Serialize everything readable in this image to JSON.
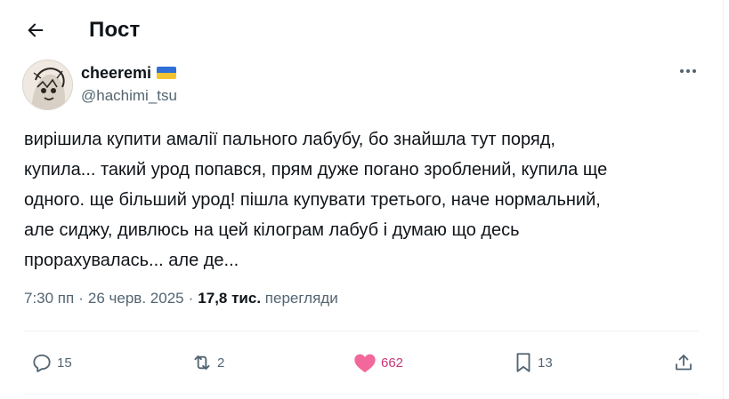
{
  "header": {
    "title": "Пост",
    "back_icon": "arrow-left-icon"
  },
  "author": {
    "display_name": "cheeremi",
    "handle": "@hachimi_tsu",
    "flag": {
      "icon": "ukraine-flag-icon",
      "colors": [
        "#2f6fd6",
        "#f4c430"
      ]
    },
    "avatar_icon": "user-avatar"
  },
  "more_icon": "more-horizontal-icon",
  "post": {
    "lines": [
      "вирішила купити амалії пального лабубу, бо знайшла тут поряд,",
      "купила... такий урод попався, прям дуже погано зроблений, купила ще",
      "одного. ще більший урод! пішла купувати третього, наче нормальний,",
      "але сиджу, дивлюсь на цей кілограм лабуб і думаю що десь",
      "прорахувалась... але де..."
    ]
  },
  "meta": {
    "time": "7:30 пп",
    "separator": "·",
    "date": "26 черв. 2025",
    "views_count": "17,8 тис.",
    "views_label": "перегляди"
  },
  "actions": {
    "reply": {
      "icon": "reply-icon",
      "count": "15"
    },
    "repost": {
      "icon": "repost-icon",
      "count": "2"
    },
    "like": {
      "icon": "heart-filled-icon",
      "count": "662",
      "color": "#e0245e"
    },
    "bookmark": {
      "icon": "bookmark-icon",
      "count": "13"
    },
    "share": {
      "icon": "share-icon"
    }
  },
  "colors": {
    "text": "#0f1419",
    "secondary": "#536471",
    "like": "#e0245e",
    "divider": "#eff3f4"
  }
}
